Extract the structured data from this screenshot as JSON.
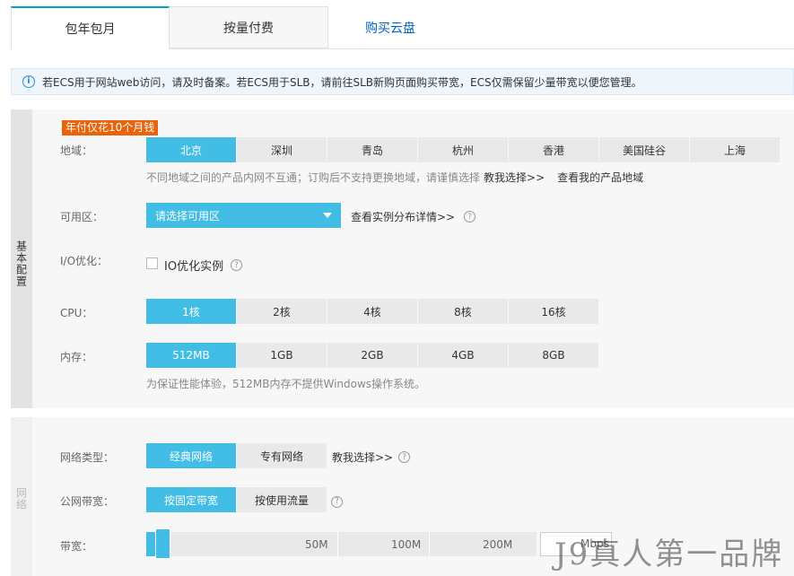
{
  "tabs": [
    {
      "label": "包年包月",
      "active": true
    },
    {
      "label": "按量付费",
      "active": false
    },
    {
      "label": "购买云盘",
      "active": false
    }
  ],
  "notice": {
    "icon": "info-icon",
    "text": "若ECS用于网站web访问，请及时备案。若ECS用于SLB，请前往SLB新购页面购买带宽，ECS仅需保留少量带宽以便您管理。"
  },
  "basic": {
    "side_label": "基本配置",
    "badge": "年付仅花10个月钱",
    "region": {
      "label": "地域：",
      "options": [
        "北京",
        "深圳",
        "青岛",
        "杭州",
        "香港",
        "美国硅谷",
        "上海"
      ],
      "selected": "北京",
      "hint": "不同地域之间的产品内网不互通；订购后不支持更换地域，请谨慎选择",
      "help_link": "教我选择>>",
      "my_regions_link": "查看我的产品地域"
    },
    "zone": {
      "label": "可用区：",
      "select_value": "请选择可用区",
      "detail_link": "查看实例分布详情>>"
    },
    "io": {
      "label": "I/O优化：",
      "checkbox_label": "IO优化实例",
      "checked": false
    },
    "cpu": {
      "label": "CPU：",
      "options": [
        "1核",
        "2核",
        "4核",
        "8核",
        "16核"
      ],
      "selected": "1核"
    },
    "memory": {
      "label": "内存：",
      "options": [
        "512MB",
        "1GB",
        "2GB",
        "4GB",
        "8GB"
      ],
      "selected": "512MB",
      "hint": "为保证性能体验，512MB内存不提供Windows操作系统。"
    }
  },
  "network": {
    "side_label": "网络",
    "type": {
      "label": "网络类型：",
      "options": [
        "经典网络",
        "专有网络"
      ],
      "selected": "经典网络",
      "help_link": "教我选择>>"
    },
    "bandwidth_mode": {
      "label": "公网带宽：",
      "options": [
        "按固定带宽",
        "按使用流量"
      ],
      "selected": "按固定带宽"
    },
    "bandwidth": {
      "label": "带宽：",
      "ticks": [
        "50M",
        "100M",
        "200M"
      ],
      "unit": "Mbps"
    }
  },
  "watermark": "J9真人第一品牌"
}
